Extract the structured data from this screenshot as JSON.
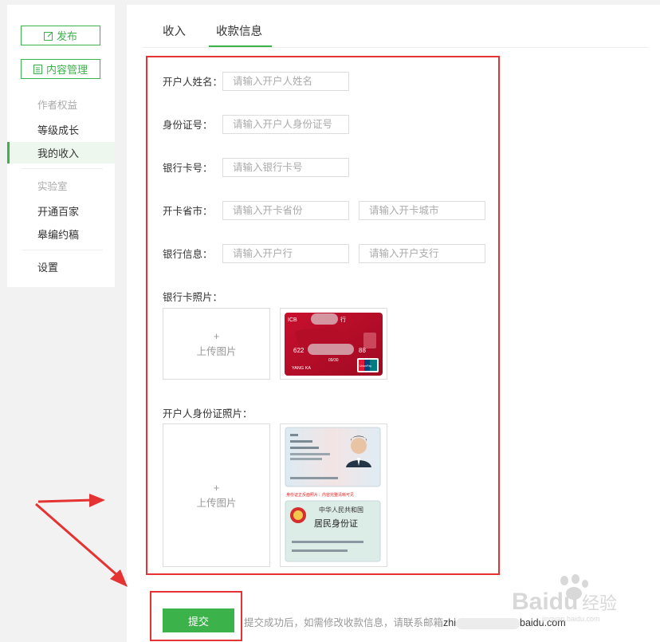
{
  "sidebar": {
    "publish_label": "发布",
    "content_manage_label": "内容管理",
    "author_rights_section": "作者权益",
    "level_growth": "等级成长",
    "my_income": "我的收入",
    "lab_section": "实验室",
    "open_baijia": "开通百家",
    "editor_invite": "皋编约稿",
    "settings": "设置"
  },
  "tabs": [
    {
      "label": "收入"
    },
    {
      "label": "收款信息"
    }
  ],
  "form": {
    "name_label": "开户人姓名：",
    "name_placeholder": "请输入开户人姓名",
    "id_label": "身份证号：",
    "id_placeholder": "请输入开户人身份证号",
    "card_label": "银行卡号：",
    "card_placeholder": "请输入银行卡号",
    "province_city_label": "开卡省市：",
    "province_placeholder": "请输入开卡省份",
    "city_placeholder": "请输入开卡城市",
    "bank_info_label": "银行信息：",
    "bank_placeholder": "请输入开户行",
    "branch_placeholder": "请输入开户支行",
    "card_photo_label": "银行卡照片：",
    "id_photo_label": "开户人身份证照片：",
    "upload_plus": "+",
    "upload_text": "上传图片"
  },
  "bank_card_sample": {
    "bank_prefix": "ICB",
    "bank_suffix": "行",
    "number_start": "622",
    "number_end": "88",
    "expiry": "09/30",
    "holder": "YANG KA",
    "union_pay": "UnionPay"
  },
  "id_card_sample": {
    "warning": "身份证正反面照片：内容完整清晰可见",
    "country": "中华人民共和国",
    "title": "居民身份证"
  },
  "footer": {
    "submit_label": "提交",
    "note_text": "提交成功后，如需修改收款信息，请联系邮箱",
    "email_start": "zhi",
    "email_end": "baidu.com"
  },
  "watermark": {
    "text": "Baidu",
    "cn": "经验",
    "url": "jingyan.baidu.com"
  },
  "colors": {
    "accent": "#3bb34a",
    "highlight": "#e53333"
  }
}
